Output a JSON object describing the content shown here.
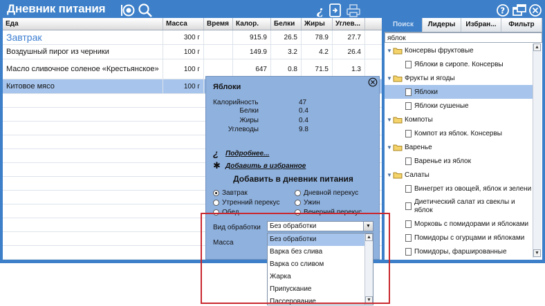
{
  "app": {
    "title": "Дневник питания"
  },
  "colors": {
    "frame": "#3d80c9",
    "selection": "#a6c4ec",
    "meal": "#3b7ed1",
    "highlight": "#c9272d"
  },
  "icons": {
    "header_left": [
      "plate-icon",
      "search-icon"
    ],
    "header_center": [
      "info-icon",
      "export-icon",
      "print-icon"
    ],
    "header_right": [
      "help-icon",
      "window-icon",
      "close-icon"
    ]
  },
  "diary": {
    "columns": [
      "Еда",
      "Масса",
      "Время",
      "Калор.",
      "Белки",
      "Жиры",
      "Углев..."
    ],
    "rows": [
      {
        "food": "Завтрак",
        "mass": "300 г",
        "time": "",
        "cal": "915.9",
        "prot": "26.5",
        "fat": "78.9",
        "carb": "27.7",
        "meal": true
      },
      {
        "food": "Воздушный пирог из черники",
        "mass": "100 г",
        "time": "",
        "cal": "149.9",
        "prot": "3.2",
        "fat": "4.2",
        "carb": "26.4"
      },
      {
        "food": "Масло сливочное соленое «Крестьянское»",
        "mass": "100 г",
        "time": "",
        "cal": "647",
        "prot": "0.8",
        "fat": "71.5",
        "carb": "1.3"
      },
      {
        "food": "Китовое мясо",
        "mass": "100 г",
        "time": "",
        "cal": "",
        "prot": "",
        "fat": "",
        "carb": "",
        "selected": true
      }
    ]
  },
  "right": {
    "tabs": [
      "Поиск",
      "Лидеры",
      "Избран...",
      "Фильтр"
    ],
    "search_value": "яблок",
    "tree": [
      {
        "type": "folder",
        "label": "Консервы фруктовые"
      },
      {
        "type": "item",
        "label": "Яблоки в сиропе. Консервы"
      },
      {
        "type": "folder",
        "label": "Фрукты и ягоды"
      },
      {
        "type": "item",
        "label": "Яблоки",
        "selected": true
      },
      {
        "type": "item",
        "label": "Яблоки сушеные"
      },
      {
        "type": "folder",
        "label": "Компоты"
      },
      {
        "type": "item",
        "label": "Компот из яблок. Консервы"
      },
      {
        "type": "folder",
        "label": "Варенье"
      },
      {
        "type": "item",
        "label": "Варенье из яблок"
      },
      {
        "type": "folder",
        "label": "Салаты"
      },
      {
        "type": "item",
        "label": "Винегрет из овощей, яблок и зелени"
      },
      {
        "type": "item",
        "label": "Диетический салат из свеклы и яблок",
        "tall": true
      },
      {
        "type": "item",
        "label": "Морковь с помидорами и яблоками"
      },
      {
        "type": "item",
        "label": "Помидоры с огурцами и яблоками"
      },
      {
        "type": "item",
        "label": "Помидоры, фаршированные"
      }
    ]
  },
  "popup": {
    "title": "Яблоки",
    "nutrients": [
      {
        "label": "Калорийность",
        "value": "47"
      },
      {
        "label": "Белки",
        "value": "0.4"
      },
      {
        "label": "Жиры",
        "value": "0.4"
      },
      {
        "label": "Углеводы",
        "value": "9.8"
      }
    ],
    "more_link": "Подробнее...",
    "fav_link": "Добавить в избранное",
    "add_title": "Добавить в дневник питания",
    "meals": [
      {
        "label": "Завтрак",
        "checked": true
      },
      {
        "label": "Дневной перекус",
        "checked": false
      },
      {
        "label": "Утренний перекус",
        "checked": false
      },
      {
        "label": "Ужин",
        "checked": false
      },
      {
        "label": "Обед",
        "checked": false
      },
      {
        "label": "Вечерний перекус",
        "checked": false
      }
    ],
    "processing_label": "Вид обработки",
    "mass_label": "Масса",
    "processing_selected": "Без обработки",
    "processing_options": [
      "Без обработки",
      "Варка без слива",
      "Варка со сливом",
      "Жарка",
      "Припускание",
      "Пассерование"
    ]
  }
}
